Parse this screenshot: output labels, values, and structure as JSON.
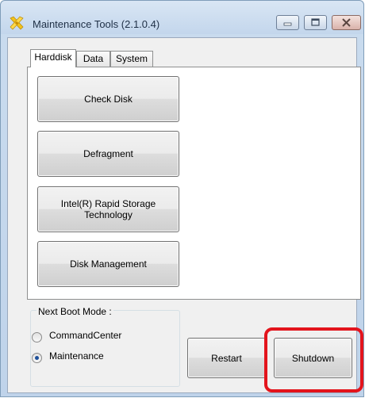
{
  "window": {
    "title": "Maintenance Tools (2.1.0.4)",
    "icon": "tools-icon",
    "controls": {
      "minimize": "minimize-icon",
      "maximize": "maximize-icon",
      "close": "close-icon"
    }
  },
  "tabs": [
    {
      "label": "Harddisk",
      "active": true
    },
    {
      "label": "Data",
      "active": false
    },
    {
      "label": "System",
      "active": false
    }
  ],
  "harddisk_buttons": [
    {
      "label": "Check Disk"
    },
    {
      "label": "Defragment"
    },
    {
      "label": "Intel(R) Rapid Storage Technology"
    },
    {
      "label": "Disk Management"
    }
  ],
  "next_boot_mode": {
    "label": "Next Boot Mode :",
    "options": [
      {
        "label": "CommandCenter",
        "selected": false
      },
      {
        "label": "Maintenance",
        "selected": true
      }
    ]
  },
  "actions": {
    "restart_label": "Restart",
    "shutdown_label": "Shutdown"
  },
  "colors": {
    "highlight": "#e3141c",
    "frame": "#c9dbee"
  }
}
